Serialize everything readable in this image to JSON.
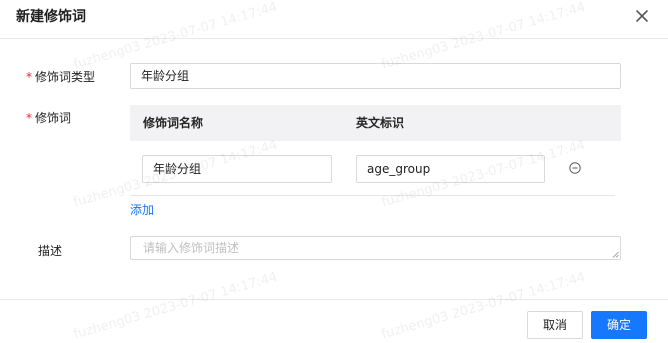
{
  "dialog": {
    "title": "新建修饰词",
    "close_icon": "close-icon"
  },
  "form": {
    "type_field": {
      "required_mark": "*",
      "label": "修饰词类型",
      "value": "年龄分组"
    },
    "modifier_field": {
      "required_mark": "*",
      "label": "修饰词",
      "table": {
        "columns": [
          "修饰词名称",
          "英文标识"
        ],
        "rows": [
          {
            "name": "年龄分组",
            "english_id": "age_group"
          }
        ],
        "remove_icon": "minus-circle-icon"
      },
      "add_link": "添加"
    },
    "description_field": {
      "label": "描述",
      "placeholder": "请输入修饰词描述"
    }
  },
  "footer": {
    "cancel_label": "取消",
    "ok_label": "确定"
  },
  "watermark": {
    "text": "fuzheng03 2023-07-07 14:17:44"
  },
  "colors": {
    "primary": "#1677ff",
    "required": "#f5222d",
    "table_header_bg": "#f2f2f4"
  }
}
